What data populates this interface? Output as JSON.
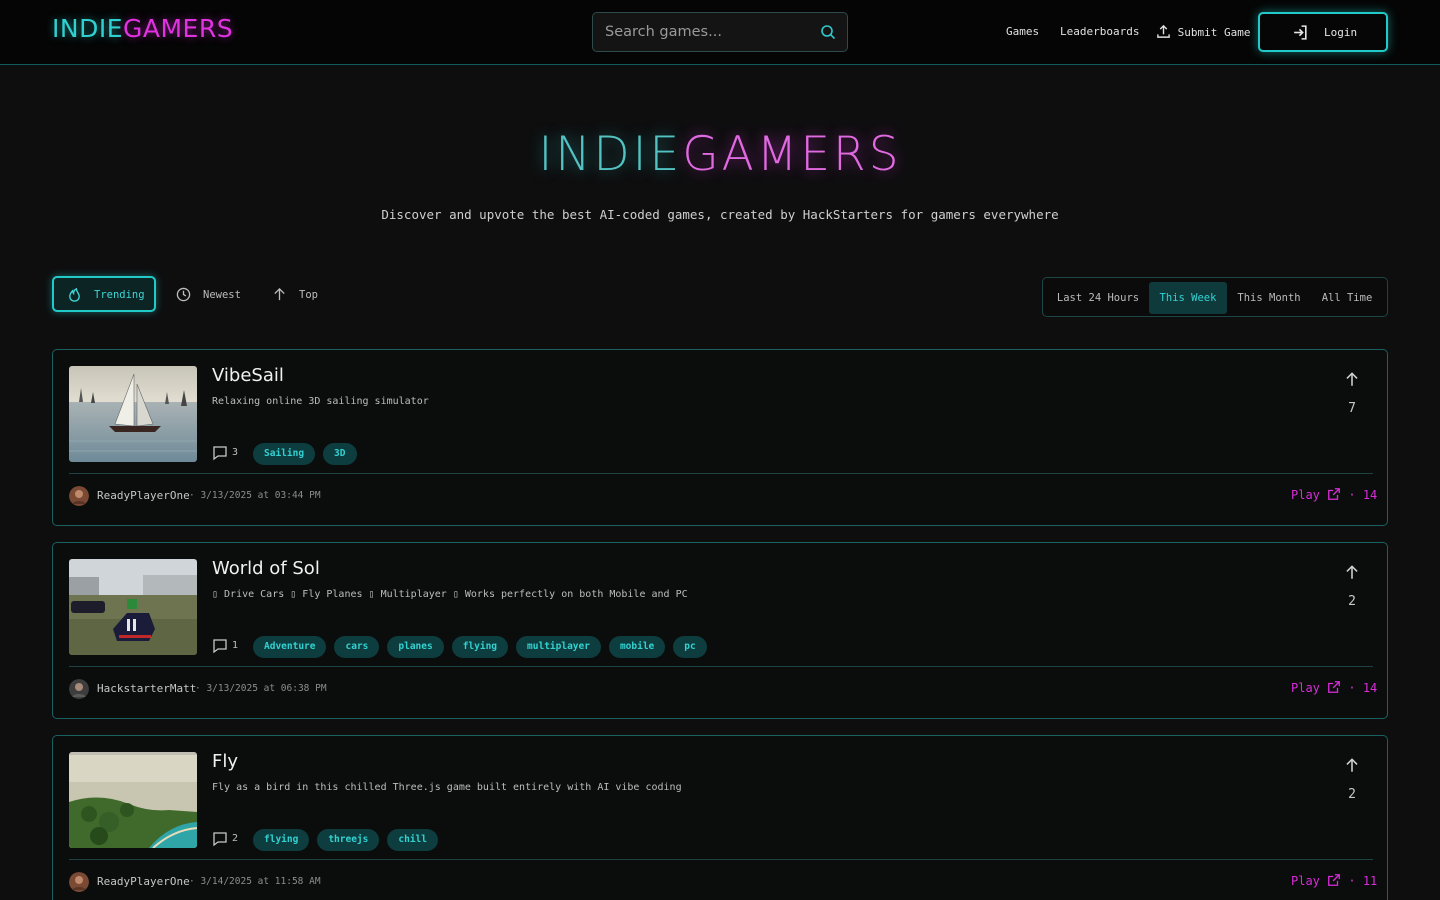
{
  "header": {
    "logo": {
      "part1": "INDIE",
      "part2": "GAMERS"
    },
    "search": {
      "placeholder": "Search games...",
      "icon": "search-icon"
    },
    "nav": [
      {
        "label": "Games"
      },
      {
        "label": "Leaderboards"
      },
      {
        "label": "Submit Game",
        "icon": "upload-icon"
      }
    ],
    "login": {
      "label": "Login",
      "icon": "login-icon"
    }
  },
  "hero": {
    "title_part1": "INDIE",
    "title_part2": "GAMERS",
    "subtitle": "Discover and upvote the best AI-coded games, created by HackStarters for gamers everywhere"
  },
  "sort": {
    "options": [
      {
        "label": "Trending",
        "icon": "flame-icon",
        "active": true
      },
      {
        "label": "Newest",
        "icon": "clock-icon",
        "active": false
      },
      {
        "label": "Top",
        "icon": "arrow-up-icon",
        "active": false
      }
    ]
  },
  "time_filter": {
    "options": [
      {
        "label": "Last 24 Hours",
        "active": false
      },
      {
        "label": "This Week",
        "active": true
      },
      {
        "label": "This Month",
        "active": false
      },
      {
        "label": "All Time",
        "active": false
      }
    ]
  },
  "games": [
    {
      "title": "VibeSail",
      "description": "Relaxing online 3D sailing simulator",
      "comments": "3",
      "tags": [
        "Sailing",
        "3D"
      ],
      "votes": "7",
      "author": "ReadyPlayerOne",
      "date": "· 3/13/2025 at 03:44 PM",
      "play_label": "Play",
      "plays": "· 14"
    },
    {
      "title": "World of Sol",
      "description": "▯ Drive Cars ▯ Fly Planes ▯ Multiplayer ▯ Works perfectly on both Mobile and PC",
      "comments": "1",
      "tags": [
        "Adventure",
        "cars",
        "planes",
        "flying",
        "multiplayer",
        "mobile",
        "pc"
      ],
      "votes": "2",
      "author": "HackstarterMatt",
      "date": "· 3/13/2025 at 06:38 PM",
      "play_label": "Play",
      "plays": "· 14"
    },
    {
      "title": "Fly",
      "description": "Fly as a bird in this chilled Three.js game built entirely with AI vibe coding",
      "comments": "2",
      "tags": [
        "flying",
        "threejs",
        "chill"
      ],
      "votes": "2",
      "author": "ReadyPlayerOne",
      "date": "· 3/14/2025 at 11:58 AM",
      "play_label": "Play",
      "plays": "· 11"
    }
  ],
  "colors": {
    "accent_cyan": "#22c9c9",
    "accent_magenta": "#d92dd9",
    "background": "#0e0e0f"
  }
}
